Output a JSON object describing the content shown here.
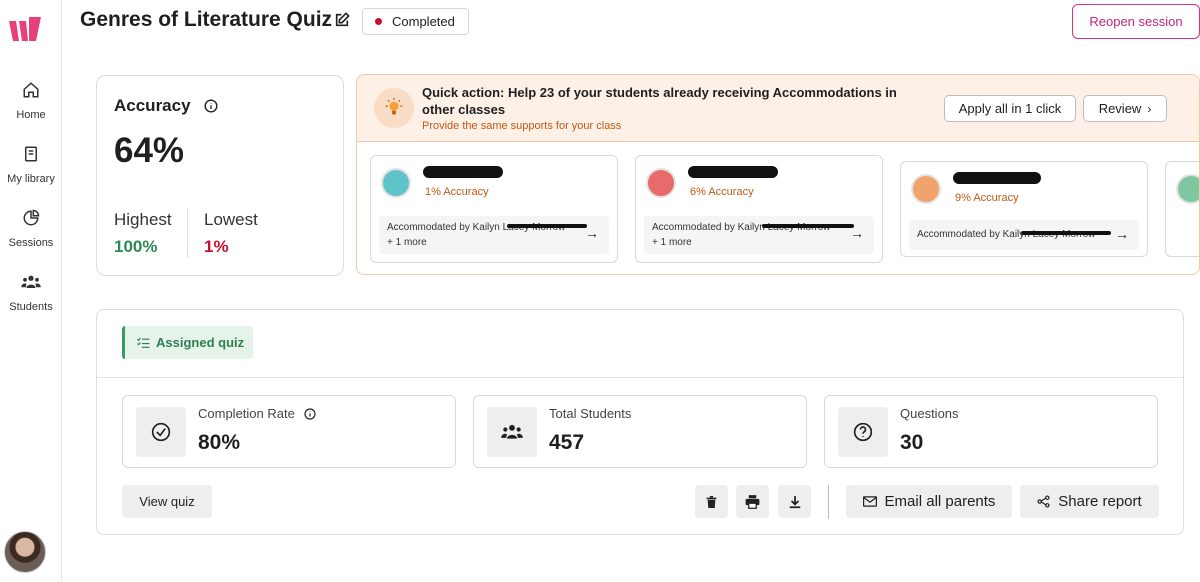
{
  "nav": {
    "items": [
      {
        "label": "Home",
        "icon": "home-icon"
      },
      {
        "label": "My library",
        "icon": "book-icon"
      },
      {
        "label": "Sessions",
        "icon": "pie-chart-icon"
      },
      {
        "label": "Students",
        "icon": "users-icon"
      }
    ]
  },
  "header": {
    "title": "Genres of Literature Quiz",
    "status": "Completed",
    "reopen_label": "Reopen session"
  },
  "accuracy": {
    "label": "Accuracy",
    "value": "64%",
    "highest_label": "Highest",
    "highest_value": "100%",
    "lowest_label": "Lowest",
    "lowest_value": "1%"
  },
  "quick_action": {
    "title": "Quick action: Help 23 of your students already receiving Accommodations in other classes",
    "subtitle": "Provide the same supports for your class",
    "apply_label": "Apply all in 1 click",
    "review_label": "Review",
    "students": [
      {
        "accuracy": "1% Accuracy",
        "accommodated_by": "Accommodated by Kailyn Lacey Morrow",
        "more": "+ 1 more"
      },
      {
        "accuracy": "6% Accuracy",
        "accommodated_by": "Accommodated by Kailyn Lacey Morrow",
        "more": "+ 1 more"
      },
      {
        "accuracy": "9% Accuracy",
        "accommodated_by": "Accommodated by Kailyn Lacey Morrow",
        "more": ""
      }
    ]
  },
  "summary": {
    "tag": "Assigned quiz",
    "stats": [
      {
        "label": "Completion Rate",
        "value": "80%"
      },
      {
        "label": "Total Students",
        "value": "457"
      },
      {
        "label": "Questions",
        "value": "30"
      }
    ],
    "view_label": "View quiz",
    "email_label": "Email all parents",
    "share_label": "Share report"
  },
  "colors": {
    "brand": "#e8407a",
    "highest": "#2f8a55",
    "lowest": "#c8102e",
    "accent_orange": "#c05a16"
  }
}
